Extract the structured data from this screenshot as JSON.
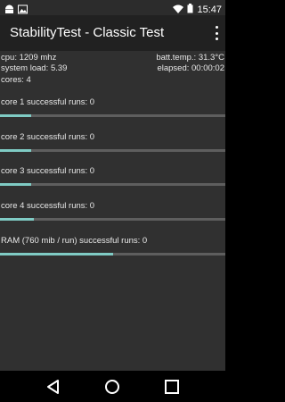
{
  "status_bar": {
    "time": "15:47"
  },
  "app_bar": {
    "title": "StabilityTest - Classic Test"
  },
  "info": {
    "cpu": "cpu: 1209 mhz",
    "batt_temp": "batt.temp.: 31.3°C",
    "system_load": "system load: 5.39",
    "elapsed": "elapsed: 00:00:02",
    "cores": "cores: 4"
  },
  "tests": [
    {
      "label": "core 1 successful runs: 0",
      "progress": 0.14
    },
    {
      "label": "core 2 successful runs: 0",
      "progress": 0.14
    },
    {
      "label": "core 3 successful runs: 0",
      "progress": 0.14
    },
    {
      "label": "core 4 successful runs: 0",
      "progress": 0.15
    },
    {
      "label": "RAM (760 mib / run) successful runs: 0",
      "progress": 0.5
    }
  ],
  "colors": {
    "progress_fill": "#7fcbc4",
    "progress_track": "#5e5e5e",
    "content_bg": "#303030",
    "app_bar_bg": "#212121"
  },
  "icons": [
    "android-icon",
    "image-icon",
    "wifi-icon",
    "battery-icon",
    "overflow-menu-icon",
    "back-icon",
    "home-icon",
    "recents-icon"
  ]
}
